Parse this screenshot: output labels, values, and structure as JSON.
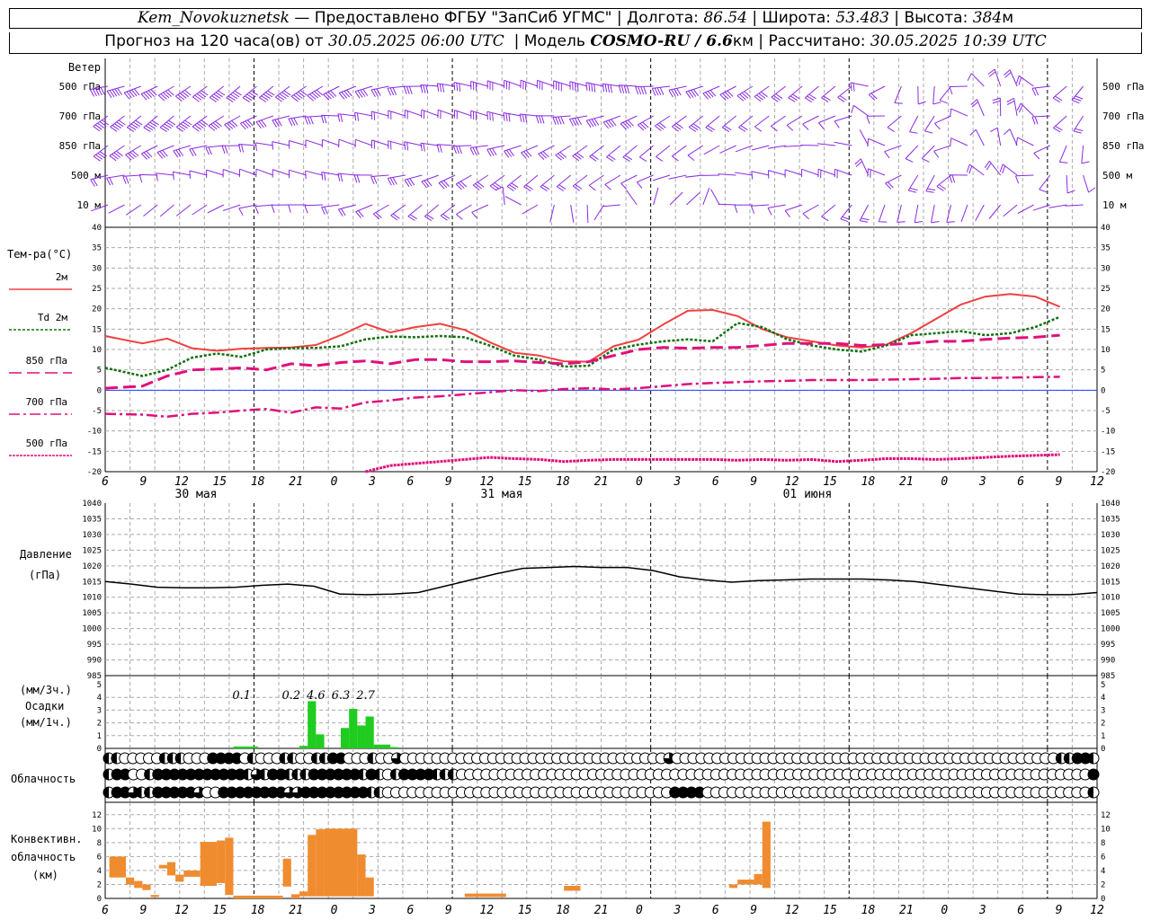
{
  "header": {
    "station": "Kem_Novokuznetsk",
    "provider": "— Предоставлено ФГБУ \"ЗапСиб УГМС\"",
    "lon_label": "Долгота:",
    "lon": "86.54",
    "lat_label": "Широта:",
    "lat": "53.483",
    "alt_label": "Высота:",
    "alt": "384",
    "alt_unit": "м",
    "forecast": "Прогноз на 120 часа(ов) от",
    "start": "30.05.2025 06:00 UTC",
    "model_label": "Модель",
    "model": "COSMO-RU / 6.6",
    "model_unit": "км",
    "calc_label": "Рассчитано:",
    "calc": "30.05.2025 10:39 UTC"
  },
  "chart_data": {
    "x_ticks": [
      "6",
      "9",
      "12",
      "15",
      "18",
      "21",
      "0",
      "3",
      "6",
      "9",
      "12",
      "15",
      "18",
      "21",
      "0",
      "3",
      "6",
      "9",
      "12",
      "15",
      "18",
      "21",
      "0",
      "3",
      "6",
      "9",
      "12"
    ],
    "dates": [
      "30 мая",
      "31 мая",
      "01 июня"
    ],
    "wind": {
      "label": "Ветер",
      "levels": [
        "500 гПа",
        "700 гПа",
        "850 гПа",
        "500 м",
        "10 м"
      ],
      "color": "#8a2be2"
    },
    "temperature": {
      "type": "line",
      "ylabel": "Тем-ра(°C)",
      "ylim": [
        -20,
        40
      ],
      "yticks": [
        "40",
        "35",
        "30",
        "25",
        "20",
        "15",
        "10",
        "5",
        "0",
        "-5",
        "-10",
        "-15",
        "-20"
      ],
      "series": [
        {
          "name": "2м",
          "color": "#f04040",
          "style": "solid",
          "values": [
            13.3,
            11.5,
            12.7,
            10.3,
            9.7,
            10.2,
            10.4,
            10.5,
            11.1,
            13.5,
            16.3,
            14.2,
            15.5,
            16.3,
            14.8,
            11.8,
            9.2,
            8.5,
            7.1,
            7.0,
            10.8,
            12.4,
            16.1,
            19.5,
            19.7,
            18.2,
            15.0,
            13.0,
            12.0,
            11.0,
            10.5,
            11.2,
            14.0,
            17.5,
            21.0,
            23.0,
            23.6,
            23.0,
            20.5
          ]
        },
        {
          "name": "Td 2м",
          "color": "#107010",
          "style": "dotted",
          "values": [
            5.5,
            3.5,
            5.0,
            8.0,
            9.0,
            8.2,
            10.0,
            10.3,
            10.4,
            10.8,
            12.5,
            13.2,
            13.0,
            13.3,
            13.0,
            11.0,
            8.5,
            7.5,
            5.8,
            6.0,
            10.0,
            11.2,
            12.0,
            12.5,
            12.0,
            16.5,
            15.5,
            12.5,
            11.0,
            10.0,
            9.5,
            11.0,
            13.5,
            14.0,
            14.5,
            13.5,
            14.0,
            15.5,
            18.0
          ]
        },
        {
          "name": "850 гПа",
          "color": "#e0107a",
          "style": "dash",
          "values": [
            0.5,
            1.0,
            3.5,
            5.0,
            5.2,
            5.5,
            5.0,
            6.5,
            6.0,
            6.8,
            7.2,
            6.5,
            7.5,
            7.5,
            7.0,
            7.0,
            7.2,
            6.8,
            6.5,
            7.0,
            8.5,
            10.0,
            10.5,
            10.3,
            10.5,
            10.5,
            11.0,
            11.5,
            11.5,
            11.5,
            11.0,
            11.2,
            11.5,
            12.0,
            12.0,
            12.5,
            12.8,
            13.0,
            13.5
          ]
        },
        {
          "name": "700 гПа",
          "color": "#e0107a",
          "style": "dashdot",
          "values": [
            -5.8,
            -6.0,
            -6.5,
            -5.8,
            -5.5,
            -5.0,
            -4.6,
            -5.5,
            -4.2,
            -4.5,
            -3.0,
            -2.5,
            -1.8,
            -1.5,
            -1.0,
            -0.5,
            0.0,
            -0.2,
            0.3,
            0.5,
            0.2,
            0.5,
            1.0,
            1.5,
            1.8,
            2.0,
            2.2,
            2.3,
            2.5,
            2.5,
            2.5,
            2.6,
            2.7,
            2.8,
            3.0,
            3.0,
            3.1,
            3.2,
            3.3
          ]
        },
        {
          "name": "500 гПа",
          "color": "#e0107a",
          "style": "dense",
          "values": [
            null,
            null,
            null,
            null,
            null,
            null,
            null,
            null,
            null,
            null,
            -20.0,
            -18.5,
            -18.0,
            -17.5,
            -17.0,
            -16.5,
            -16.8,
            -17.0,
            -17.5,
            -17.2,
            -17.0,
            -17.0,
            -17.0,
            -17.0,
            -17.0,
            -17.2,
            -17.0,
            -17.2,
            -17.0,
            -17.5,
            -17.2,
            -16.8,
            -16.8,
            -17.0,
            -16.8,
            -16.5,
            -16.2,
            -16.0,
            -15.8
          ]
        }
      ]
    },
    "pressure": {
      "type": "line",
      "ylabel": "Давление",
      "yunit": "(гПа)",
      "ylim": [
        985,
        1040
      ],
      "yticks": [
        "1040",
        "1035",
        "1030",
        "1025",
        "1020",
        "1015",
        "1010",
        "1005",
        "1000",
        "995",
        "990",
        "985"
      ],
      "color": "#000000",
      "values": [
        1015,
        1014.2,
        1013.2,
        1013,
        1013,
        1013.2,
        1013.8,
        1014.2,
        1013.5,
        1011,
        1010.8,
        1011,
        1011.5,
        1013.5,
        1015.5,
        1017.5,
        1019.2,
        1019.5,
        1019.8,
        1019.5,
        1019.5,
        1018.5,
        1016.5,
        1015.5,
        1014.8,
        1015.3,
        1015.5,
        1015.8,
        1015.8,
        1015.8,
        1015.5,
        1015,
        1014,
        1013,
        1012,
        1011,
        1010.8,
        1010.8,
        1011.5
      ]
    },
    "precip": {
      "type": "bar",
      "ylabel": "Осадки",
      "unit_top": "(мм/3ч.)",
      "unit_bottom": "(мм/1ч.)",
      "ylim": [
        0,
        5
      ],
      "yticks": [
        "5",
        "4",
        "3",
        "2",
        "1",
        "0"
      ],
      "color": "#1fcc1f",
      "hours": [
        16,
        17,
        18,
        24,
        25,
        26,
        29,
        30,
        31,
        32,
        33,
        34,
        35
      ],
      "values": [
        0.15,
        0.15,
        0.15,
        0.2,
        3.7,
        1.1,
        1.6,
        3.1,
        1.8,
        2.5,
        0.3,
        0.3,
        0.1
      ],
      "totals": [
        {
          "label": "0.1",
          "hour": 16.5
        },
        {
          "label": "0.2",
          "hour": 22.5
        },
        {
          "label": "4.6",
          "hour": 25.5
        },
        {
          "label": "6.3",
          "hour": 28.5
        },
        {
          "label": "2.7",
          "hour": 31.5
        }
      ]
    },
    "cloud": {
      "label": "Облачность",
      "rows": [
        "1100000111000222201000110011220001003000000000000000000000000000000000300000000000000000000000000000000000000000000000011221",
        "1220012222222222213122111222222121012222111000000000000000000000000000000000000000000000000000000000000000000000000000002",
        "1223112222230022222222332222222211000000000000000000000000000000000002222000000000000000000000000000000000000000000000001"
      ]
    },
    "convective": {
      "type": "bar",
      "ylabel_1": "Конвективн.",
      "ylabel_2": "облачность",
      "ylabel_3": "(км)",
      "ylim": [
        0,
        13
      ],
      "yticks": [
        "12",
        "10",
        "8",
        "6",
        "4",
        "2",
        "0"
      ],
      "color": "#f08c30",
      "segments": [
        {
          "h0": 0.5,
          "h1": 2.5,
          "top": 6,
          "base": 3
        },
        {
          "h0": 2.5,
          "h1": 3.5,
          "top": 3,
          "base": 2
        },
        {
          "h0": 3.5,
          "h1": 4.5,
          "top": 2.5,
          "base": 1.5
        },
        {
          "h0": 4.5,
          "h1": 5.5,
          "top": 2,
          "base": 1.2
        },
        {
          "h0": 5.5,
          "h1": 6.5,
          "top": 0.5,
          "base": 0.2
        },
        {
          "h0": 6.5,
          "h1": 7.5,
          "top": 4.8,
          "base": 4.3
        },
        {
          "h0": 7.5,
          "h1": 8.5,
          "top": 5.2,
          "base": 3.3
        },
        {
          "h0": 8.5,
          "h1": 9.5,
          "top": 3.4,
          "base": 2.4
        },
        {
          "h0": 9.5,
          "h1": 11.5,
          "top": 4,
          "base": 3.1
        },
        {
          "h0": 11.5,
          "h1": 13.5,
          "top": 8.1,
          "base": 1.8
        },
        {
          "h0": 13.5,
          "h1": 14.5,
          "top": 8.3,
          "base": 2.2
        },
        {
          "h0": 14.5,
          "h1": 15.5,
          "top": 8.7,
          "base": 0.5
        },
        {
          "h0": 15.5,
          "h1": 21.5,
          "top": 0.4,
          "base": 0
        },
        {
          "h0": 21.5,
          "h1": 22.5,
          "top": 5.7,
          "base": 1.7
        },
        {
          "h0": 22.5,
          "h1": 23.5,
          "top": 0.6,
          "base": 0
        },
        {
          "h0": 23.5,
          "h1": 24.5,
          "top": 1,
          "base": 0.3
        },
        {
          "h0": 24.5,
          "h1": 25.5,
          "top": 9.1,
          "base": 0.3
        },
        {
          "h0": 25.5,
          "h1": 26.5,
          "top": 9.9,
          "base": 0.3
        },
        {
          "h0": 26.5,
          "h1": 30.5,
          "top": 10,
          "base": 0.3
        },
        {
          "h0": 30.5,
          "h1": 31.5,
          "top": 6.3,
          "base": 0.3
        },
        {
          "h0": 31.5,
          "h1": 32.5,
          "top": 3,
          "base": 0.3
        },
        {
          "h0": 43.5,
          "h1": 48.5,
          "top": 0.7,
          "base": 0.2
        },
        {
          "h0": 55.5,
          "h1": 57.5,
          "top": 1.8,
          "base": 1.1
        },
        {
          "h0": 75.5,
          "h1": 76.5,
          "top": 2,
          "base": 1.5
        },
        {
          "h0": 76.5,
          "h1": 78.5,
          "top": 2.7,
          "base": 2
        },
        {
          "h0": 78.5,
          "h1": 79.5,
          "top": 3.5,
          "base": 2
        },
        {
          "h0": 79.5,
          "h1": 80.5,
          "top": 11,
          "base": 1.5
        }
      ]
    }
  }
}
